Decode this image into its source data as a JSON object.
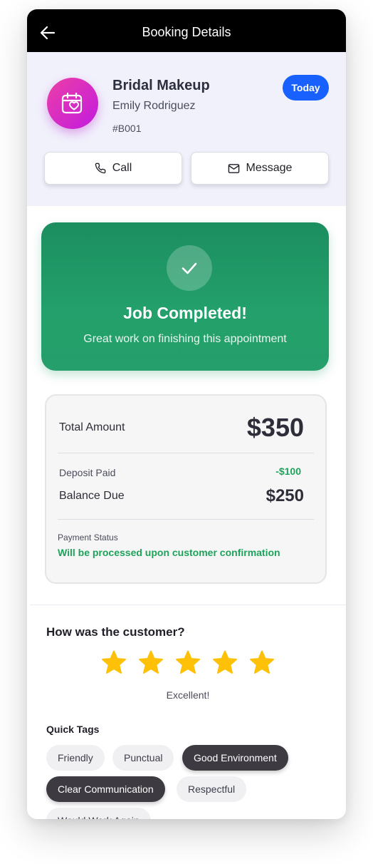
{
  "topbar": {
    "title": "Booking Details"
  },
  "booking": {
    "service": "Bridal Makeup",
    "customer": "Emily Rodriguez",
    "id": "#B001",
    "badge": "Today"
  },
  "actions": {
    "call": "Call",
    "message": "Message"
  },
  "completion": {
    "title": "Job Completed!",
    "subtitle": "Great work on finishing this appointment"
  },
  "payment": {
    "total_label": "Total Amount",
    "total_value": "$350",
    "deposit_label": "Deposit Paid",
    "deposit_value": "-$100",
    "balance_label": "Balance Due",
    "balance_value": "$250",
    "status_label": "Payment Status",
    "status_value": "Will be processed upon customer confirmation"
  },
  "rating": {
    "question": "How was the customer?",
    "stars": 5,
    "max_stars": 5,
    "text": "Excellent!",
    "tags_label": "Quick Tags",
    "tags": [
      {
        "label": "Friendly",
        "selected": false
      },
      {
        "label": "Punctual",
        "selected": false
      },
      {
        "label": "Good Environment",
        "selected": true
      },
      {
        "label": "Clear Communication",
        "selected": true
      },
      {
        "label": "Respectful",
        "selected": false
      },
      {
        "label": "Would Work Again",
        "selected": false
      }
    ]
  },
  "colors": {
    "accent_blue": "#1861ff",
    "success_green": "#1ea35a",
    "star_yellow": "#ffc107",
    "avatar_pink": "#ec3fa6",
    "avatar_purple": "#c21ae0"
  },
  "icons": {
    "back": "arrow-left-icon",
    "avatar": "calendar-heart-icon",
    "call": "phone-icon",
    "message": "mail-icon",
    "completed": "check-icon",
    "rating": "star-icon"
  }
}
